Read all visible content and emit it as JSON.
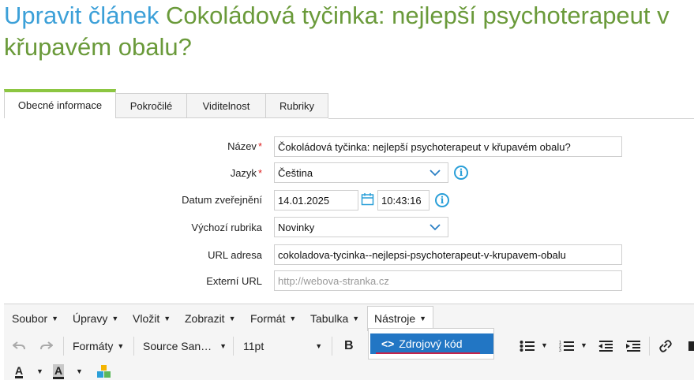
{
  "page": {
    "title_prefix": "Upravit článek",
    "title_article": "Cokoládová tyčinka: nejlepší psychoterapeut v křupavém obalu?"
  },
  "tabs": [
    {
      "label": "Obecné informace",
      "active": true
    },
    {
      "label": "Pokročilé"
    },
    {
      "label": "Viditelnost"
    },
    {
      "label": "Rubriky"
    }
  ],
  "form": {
    "name_label": "Název",
    "name_value": "Čokoládová tyčinka: nejlepší psychoterapeut v křupavém obalu?",
    "language_label": "Jazyk",
    "language_value": "Čeština",
    "date_label": "Datum zveřejnění",
    "date_value": "14.01.2025",
    "time_value": "10:43:16",
    "rubric_label": "Výchozí rubrika",
    "rubric_value": "Novinky",
    "url_label": "URL adresa",
    "url_value": "cokoladova-tycinka--nejlepsi-psychoterapeut-v-krupavem-obalu",
    "external_label": "Externí URL",
    "external_placeholder": "http://webova-stranka.cz",
    "required_mark": "*"
  },
  "editor": {
    "menus": [
      "Soubor",
      "Úpravy",
      "Vložit",
      "Zobrazit",
      "Formát",
      "Tabulka",
      "Nástroje"
    ],
    "open_menu": "Nástroje",
    "formats_label": "Formáty",
    "font_family": "Source San…",
    "font_size": "11pt",
    "bold_label": "B",
    "text_color_label": "A",
    "bg_color_label": "A",
    "dropdown_item_icon": "<>",
    "dropdown_item": "Zdrojový kód"
  },
  "colors": {
    "title_prefix": "#3ca0d8",
    "title_article": "#6a9a3a",
    "tab_active_border": "#8cc641",
    "info_icon": "#2a9fd8",
    "dropdown_highlight": "#2276c4",
    "required": "#d22222"
  },
  "icons": [
    "info-icon",
    "calendar-icon",
    "chevron-down-icon",
    "undo-icon",
    "redo-icon",
    "bullet-list-icon",
    "numbered-list-icon",
    "outdent-icon",
    "indent-icon",
    "link-icon",
    "code-icon",
    "color-grid-icon"
  ]
}
